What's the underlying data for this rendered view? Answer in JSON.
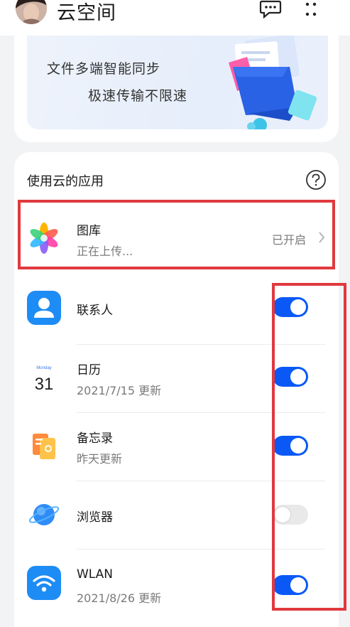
{
  "header": {
    "title": "云空间"
  },
  "banner": {
    "line1": "文件多端智能同步",
    "line2": "极速传输不限速"
  },
  "section": {
    "title": "使用云的应用"
  },
  "gallery": {
    "name": "图库",
    "sub": "正在上传...",
    "status": "已开启"
  },
  "apps": [
    {
      "name": "联系人",
      "sub": "",
      "enabled": true,
      "icon": "contacts-icon"
    },
    {
      "name": "日历",
      "sub": "2021/7/15 更新",
      "enabled": true,
      "icon": "calendar-icon",
      "icon_month": "Monday",
      "icon_day": "31"
    },
    {
      "name": "备忘录",
      "sub": "昨天更新",
      "enabled": true,
      "icon": "notepad-icon"
    },
    {
      "name": "浏览器",
      "sub": "",
      "enabled": false,
      "icon": "browser-icon"
    },
    {
      "name": "WLAN",
      "sub": "2021/8/26 更新",
      "enabled": true,
      "icon": "wlan-icon"
    }
  ],
  "colors": {
    "accent": "#0a59f7",
    "annotation": "#e0393e"
  }
}
